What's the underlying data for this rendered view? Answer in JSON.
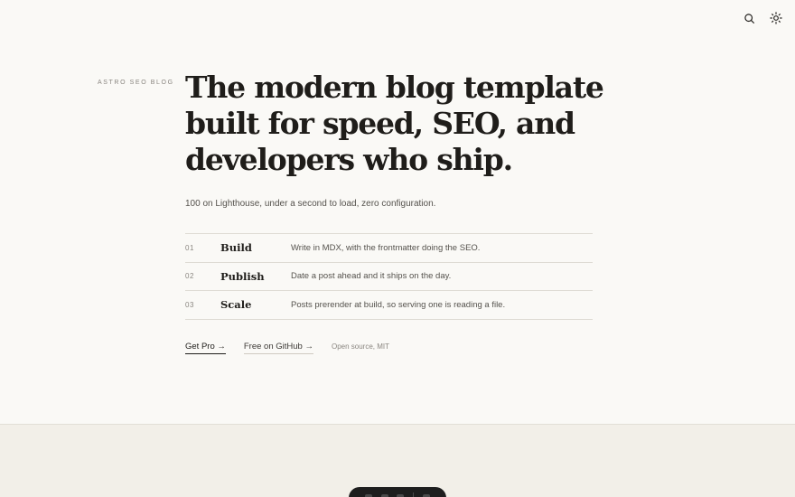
{
  "header": {
    "search_icon": "search-icon",
    "theme_icon": "sun-icon"
  },
  "hero": {
    "eyebrow": "ASTRO SEO BLOG",
    "headline": "The modern blog template built for speed, SEO, and developers who ship.",
    "subhead": "100 on Lighthouse, under a second to load, zero configuration."
  },
  "steps": [
    {
      "num": "01",
      "title": "Build",
      "desc": "Write in MDX, with the frontmatter doing the SEO."
    },
    {
      "num": "02",
      "title": "Publish",
      "desc": "Date a post ahead and it ships on the day."
    },
    {
      "num": "03",
      "title": "Scale",
      "desc": "Posts prerender at build, so serving one is reading a file."
    }
  ],
  "actions": {
    "primary": "Get Pro →",
    "secondary": "Free on GitHub →",
    "note": "Open source, MIT"
  },
  "colors": {
    "background": "#faf9f6",
    "text": "#1f1d1a",
    "muted": "#8a8680",
    "lower_section": "#f2efe8",
    "dock": "#1e1e1e"
  }
}
